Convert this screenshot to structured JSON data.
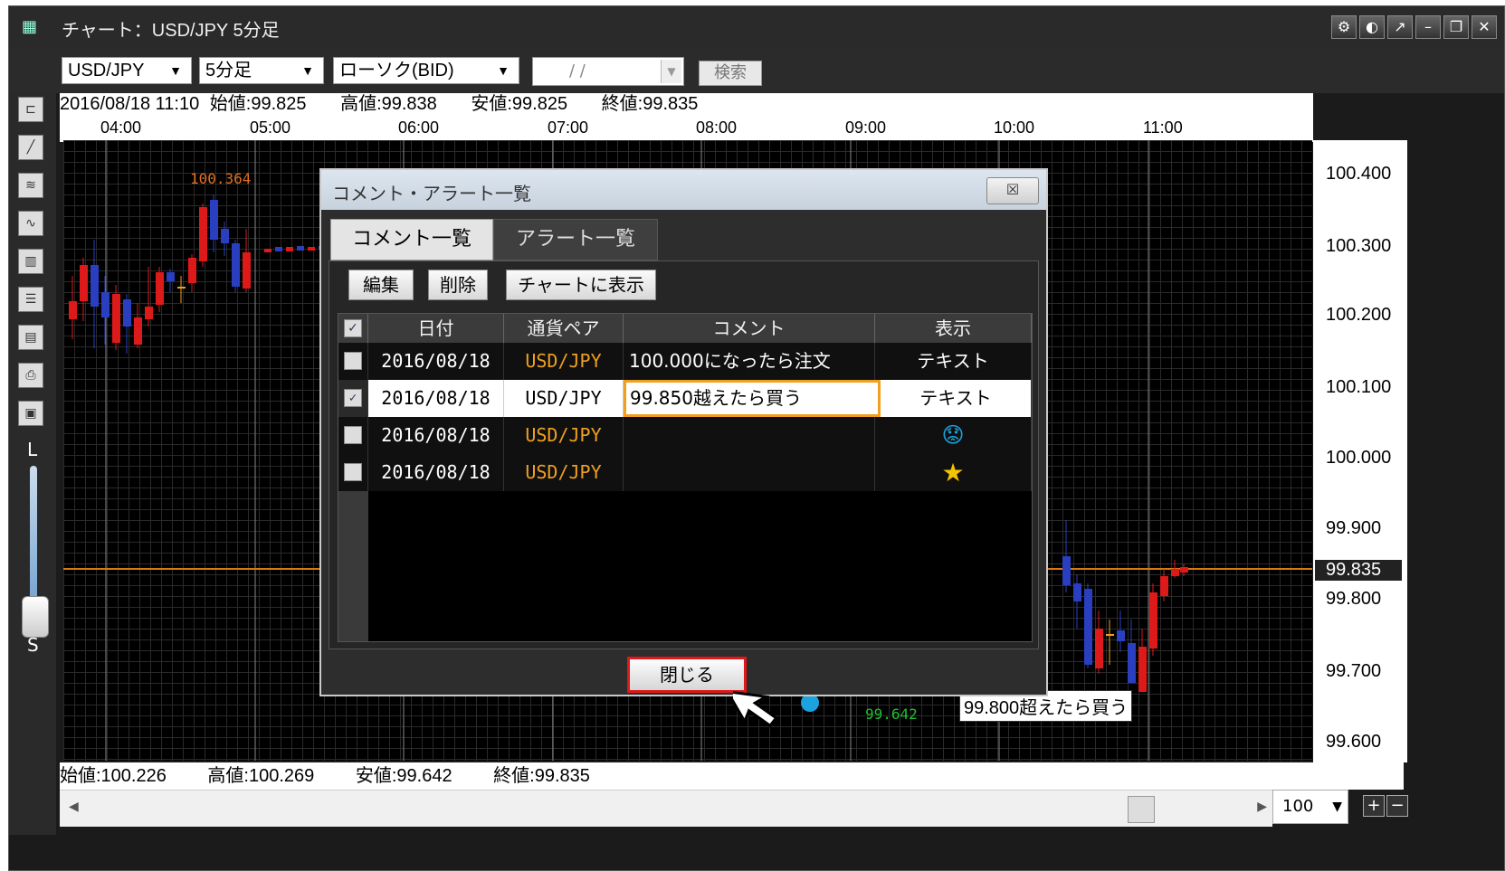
{
  "window": {
    "title": "チャート：USD/JPY 5分足",
    "controls": [
      "gear-icon",
      "palette-icon",
      "popout-icon",
      "minimize-icon",
      "restore-icon",
      "close-icon"
    ]
  },
  "toolbar": {
    "pair": "USD/JPY",
    "timeframe": "5分足",
    "chart_type": "ローソク(BID)",
    "date_placeholder": "/ /",
    "search_label": "検索"
  },
  "info": {
    "datetime": "2016/08/18 11:10",
    "open": "始値:99.825",
    "high": "高値:99.838",
    "low": "安値:99.825",
    "close": "終値:99.835"
  },
  "time_axis": [
    "04:00",
    "05:00",
    "06:00",
    "07:00",
    "08:00",
    "09:00",
    "10:00",
    "11:00"
  ],
  "price_axis": [
    "100.400",
    "100.300",
    "100.200",
    "100.100",
    "100.000",
    "99.900",
    "99.835",
    "99.800",
    "99.700",
    "99.600"
  ],
  "chart": {
    "high_marker": "100.364",
    "low_marker": "99.642",
    "alert_note": "99.800超えたら買う",
    "current_price": "99.835"
  },
  "footer": {
    "open": "始値:100.226",
    "high": "高値:100.269",
    "low": "安値:99.642",
    "close": "終値:99.835"
  },
  "zoom": {
    "value": "100"
  },
  "slider": {
    "top": "L",
    "bottom": "S"
  },
  "dialog": {
    "title": "コメント・アラート一覧",
    "close_x": "☒",
    "tabs": [
      "コメント一覧",
      "アラート一覧"
    ],
    "buttons": {
      "edit": "編集",
      "delete": "削除",
      "show_on_chart": "チャートに表示"
    },
    "columns": [
      "日付",
      "通貨ペア",
      "コメント",
      "表示"
    ],
    "rows": [
      {
        "date": "2016/08/18",
        "pair": "USD/JPY",
        "comment": "100.000になったら注文",
        "display": "テキスト",
        "checked": false
      },
      {
        "date": "2016/08/18",
        "pair": "USD/JPY",
        "comment": "99.850越えたら買う",
        "display": "テキスト",
        "checked": true
      },
      {
        "date": "2016/08/18",
        "pair": "USD/JPY",
        "comment": "",
        "display": "😟",
        "checked": false
      },
      {
        "date": "2016/08/18",
        "pair": "USD/JPY",
        "comment": "",
        "display": "★",
        "checked": false
      }
    ],
    "close_label": "閉じる"
  },
  "colors": {
    "bull": "#dd1a1a",
    "bear": "#2a3fbf",
    "hline": "#d87a12",
    "accent": "#f0a020"
  }
}
